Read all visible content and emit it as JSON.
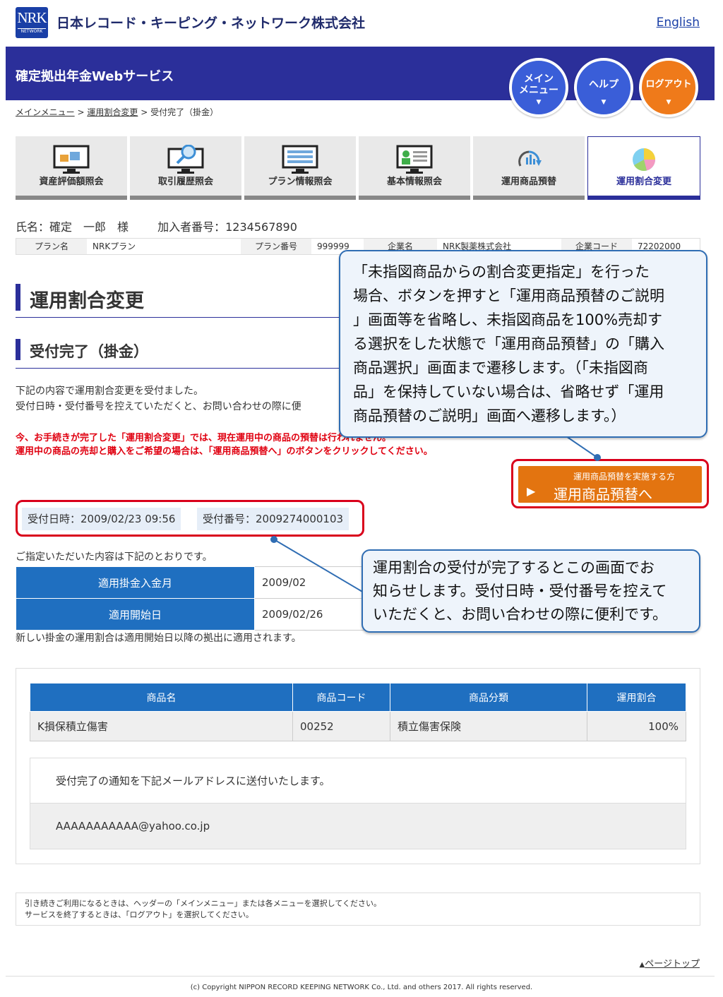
{
  "header": {
    "logo_main": "NRK",
    "logo_sub": "NETWORK",
    "company": "日本レコード・キーピング・ネットワーク株式会社",
    "english_link": "English",
    "service_name": "確定拠出年金Webサービス",
    "nav": {
      "menu_line1": "メイン",
      "menu_line2": "メニュー",
      "help": "ヘルプ",
      "logout": "ログアウト"
    }
  },
  "breadcrumb": {
    "item1": "メインメニュー",
    "item2": "運用割合変更",
    "current": "受付完了（掛金）",
    "sep": ">"
  },
  "tabs": [
    {
      "label": "資産評価額照会",
      "icon": "asset-monitor-icon"
    },
    {
      "label": "取引履歴照会",
      "icon": "magnifier-monitor-icon"
    },
    {
      "label": "プラン情報照会",
      "icon": "list-monitor-icon"
    },
    {
      "label": "基本情報照会",
      "icon": "profile-monitor-icon"
    },
    {
      "label": "運用商品預替",
      "icon": "exchange-arrows-icon"
    },
    {
      "label": "運用割合変更",
      "icon": "pie-chart-icon"
    }
  ],
  "person": {
    "name": "氏名：確定　一郎　様",
    "member_no": "加入者番号：1234567890"
  },
  "plan": {
    "plan_name_label": "プラン名",
    "plan_name": "NRKプラン",
    "plan_no_label": "プラン番号",
    "plan_no": "999999",
    "company_label": "企業名",
    "company": "NRK製薬株式会社",
    "company_code_label": "企業コード",
    "company_code": "72202000"
  },
  "page": {
    "title": "運用割合変更",
    "subtitle": "受付完了（掛金）",
    "intro_line1": "下記の内容で運用割合変更を受付ました。",
    "intro_line2": "受付日時・受付番号を控えていただくと、お問い合わせの際に便",
    "warning_line1": "今、お手続きが完了した「運用割合変更」では、現在運用中の商品の預替は行われません。",
    "warning_line2": "運用中の商品の売却と購入をご希望の場合は、「運用商品預替へ」のボタンをクリックしてください。",
    "switch_button_sub": "運用商品預替を実施する方",
    "switch_button_main": "運用商品預替へ",
    "receipt_datetime": "受付日時：2009/02/23 09:56",
    "receipt_number": "受付番号：2009274000103",
    "specified_text": "ご指定いただいた内容は下記のとおりです。",
    "apply_rows": [
      {
        "label": "適用掛金入金月",
        "value": "2009/02"
      },
      {
        "label": "適用開始日",
        "value": "2009/02/26"
      }
    ],
    "apply_note": "新しい掛金の運用割合は適用開始日以降の拠出に適用されます。"
  },
  "products": {
    "headers": [
      "商品名",
      "商品コード",
      "商品分類",
      "運用割合"
    ],
    "rows": [
      [
        "K損保積立傷害",
        "00252",
        "積立傷害保険",
        "100%"
      ]
    ]
  },
  "mail": {
    "notice": "受付完了の通知を下記メールアドレスに送付いたします。",
    "address": "AAAAAAAAAAA@yahoo.co.jp"
  },
  "footer": {
    "note_line1": "引き続きご利用になるときは、ヘッダーの「メインメニュー」または各メニューを選択してください。",
    "note_line2": "サービスを終了するときは、「ログアウト」を選択してください。",
    "page_top": "ページトップ",
    "copyright": "(c) Copyright NIPPON RECORD KEEPING NETWORK Co., Ltd. and others 2017. All rights reserved."
  },
  "callouts": {
    "c1_lines": [
      "「未指図商品からの割合変更指定」を行った",
      "場合、ボタンを押すと「運用商品預替のご説明",
      "」画面等を省略し、未指図商品を100%売却す",
      "る選択をした状態で「運用商品預替」の「購入",
      "商品選択」画面まで遷移します。（「未指図商",
      "品」を保持していない場合は、省略せず「運用",
      "商品預替のご説明」画面へ遷移します。）"
    ],
    "c2_lines": [
      "運用割合の受付が完了するとこの画面でお",
      "知らせします。受付日時・受付番号を控えて",
      "いただくと、お問い合わせの際に便利です。"
    ]
  },
  "colors": {
    "navy": "#2b2f9a",
    "table_blue": "#1f6fc0",
    "warning_red": "#e00010",
    "button_orange": "#e37410",
    "callout_border": "#2f6db3"
  }
}
